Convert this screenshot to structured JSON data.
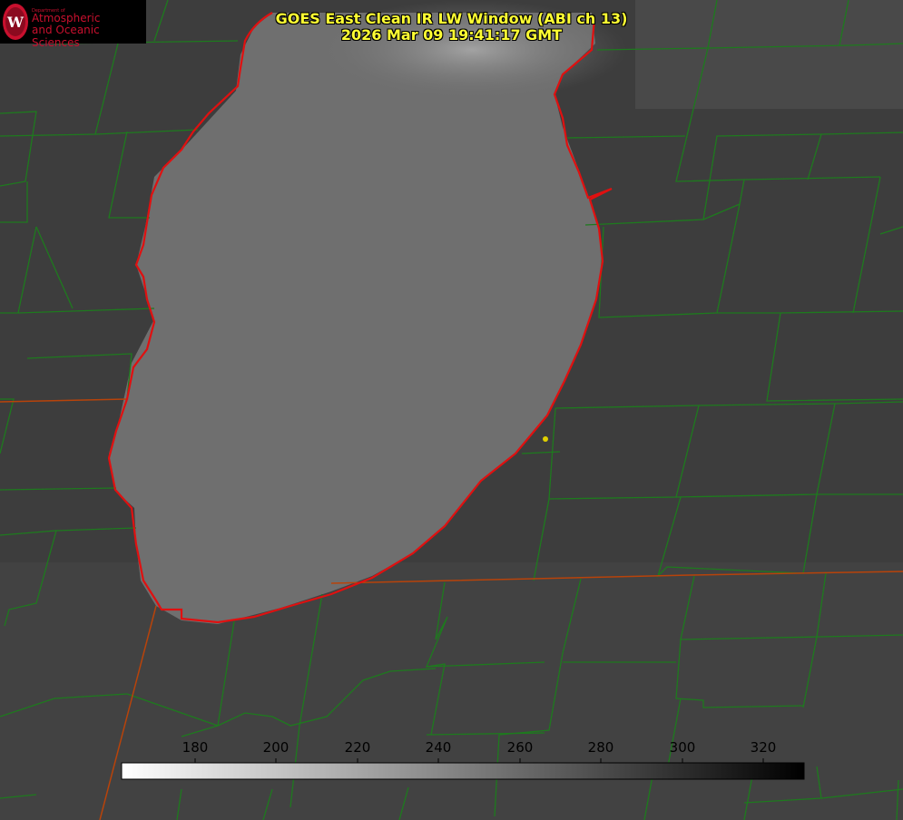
{
  "logo": {
    "department": "Department of",
    "line1": "Atmospheric",
    "line2": "and Oceanic Sciences",
    "seal_color": "#c8102e"
  },
  "title": {
    "line1": "GOES East Clean IR LW Window (ABI ch 13)",
    "line2": "2026 Mar 09 19:41:17 GMT"
  },
  "colors": {
    "title": "#ffff33",
    "shoreline": "#e01010",
    "county_lines": "#1e7a1e",
    "state_lines": "#b8430a",
    "station_marker": "#e0d000",
    "land": "#3c3c3c",
    "lake": "#6f6f6f"
  },
  "colorbar": {
    "ticks": [
      "180",
      "200",
      "220",
      "240",
      "260",
      "280",
      "300",
      "320"
    ],
    "gradient": "white-to-black"
  }
}
